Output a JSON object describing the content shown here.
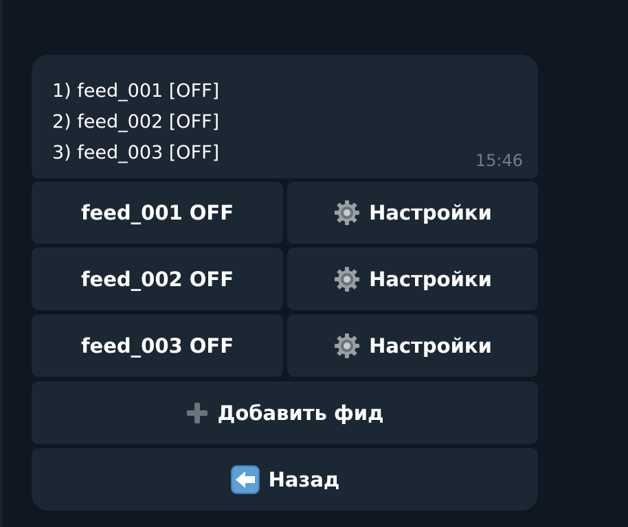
{
  "message": {
    "lines": [
      "1) feed_001 [OFF]",
      "2) feed_002 [OFF]",
      "3) feed_003 [OFF]"
    ],
    "time": "15:46"
  },
  "keyboard": {
    "rows": [
      {
        "feed_label": "feed_001 OFF",
        "settings_label": "Настройки",
        "settings_icon": "gear-icon"
      },
      {
        "feed_label": "feed_002 OFF",
        "settings_label": "Настройки",
        "settings_icon": "gear-icon"
      },
      {
        "feed_label": "feed_003 OFF",
        "settings_label": "Настройки",
        "settings_icon": "gear-icon"
      }
    ],
    "add_feed_label": "Добавить фид",
    "add_feed_icon": "plus-icon",
    "back_label": "Назад",
    "back_icon": "left-arrow-icon"
  },
  "colors": {
    "background": "#0f1723",
    "bubble": "#1c2734",
    "text": "#ffffff",
    "time": "#6e7c8c"
  }
}
